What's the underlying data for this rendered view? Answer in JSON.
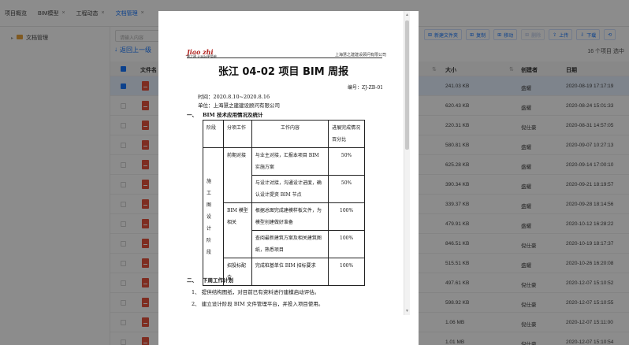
{
  "tabs": [
    {
      "label": "项目概览",
      "close": ""
    },
    {
      "label": "BIM模型",
      "close": "×"
    },
    {
      "label": "工程动态",
      "close": "×"
    },
    {
      "label": "文档管理",
      "close": "×"
    }
  ],
  "sidebar": {
    "folder_label": "文档管理"
  },
  "search": {
    "placeholder": "请输入内容"
  },
  "back_label": "返回上一级",
  "toolbar": [
    {
      "label": "新建文件夹",
      "icon": "new-folder-icon",
      "icon_glyph": "⊞"
    },
    {
      "label": "复制",
      "icon": "copy-icon",
      "icon_glyph": "⊞"
    },
    {
      "label": "移动",
      "icon": "move-icon",
      "icon_glyph": "⊞"
    },
    {
      "label": "删除",
      "icon": "delete-icon",
      "icon_glyph": "⊞"
    },
    {
      "label": "上传",
      "icon": "upload-icon",
      "icon_glyph": "⇪"
    },
    {
      "label": "下载",
      "icon": "download-icon",
      "icon_glyph": "⇩"
    },
    {
      "label": "⟲",
      "icon": "share-icon",
      "icon_glyph": ""
    }
  ],
  "item_count": "16 个项目 选中",
  "columns": {
    "name": "文件名",
    "size": "大小",
    "creator": "创建者",
    "date": "日期"
  },
  "files": [
    {
      "size": "241.03 KB",
      "creator": "盛耀",
      "date": "2020-08-19 17:17:19",
      "selected": true
    },
    {
      "size": "620.43 KB",
      "creator": "盛耀",
      "date": "2020-08-24 15:01:33",
      "selected": false
    },
    {
      "size": "220.31 KB",
      "creator": "倪仕豪",
      "date": "2020-08-31 14:57:05",
      "selected": false
    },
    {
      "size": "580.81 KB",
      "creator": "盛耀",
      "date": "2020-09-07 10:27:13",
      "selected": false
    },
    {
      "size": "625.28 KB",
      "creator": "盛耀",
      "date": "2020-09-14 17:00:10",
      "selected": false
    },
    {
      "size": "390.34 KB",
      "creator": "盛耀",
      "date": "2020-09-21 18:19:57",
      "selected": false
    },
    {
      "size": "339.37 KB",
      "creator": "盛耀",
      "date": "2020-09-28 18:14:56",
      "selected": false
    },
    {
      "size": "479.91 KB",
      "creator": "盛耀",
      "date": "2020-10-12 16:28:22",
      "selected": false
    },
    {
      "size": "846.51 KB",
      "creator": "倪仕豪",
      "date": "2020-10-19 18:17:37",
      "selected": false
    },
    {
      "size": "515.51 KB",
      "creator": "盛耀",
      "date": "2020-10-26 16:20:08",
      "selected": false
    },
    {
      "size": "497.61 KB",
      "creator": "倪仕豪",
      "date": "2020-12-07 15:10:52",
      "selected": false
    },
    {
      "size": "598.92 KB",
      "creator": "倪仕豪",
      "date": "2020-12-07 15:10:55",
      "selected": false
    },
    {
      "size": "1.06 MB",
      "creator": "倪仕豪",
      "date": "2020-12-07 15:11:00",
      "selected": false
    },
    {
      "size": "1.01 MB",
      "creator": "倪仕豪",
      "date": "2020-12-07 15:10:54",
      "selected": false
    }
  ],
  "document": {
    "logo_text": "Jiao zhi",
    "logo_sub": "慧之建 让BIM更简单",
    "header_company": "上海慧之建建设顾问有限公司",
    "title": "张江 04-02 项目 BIM 周报",
    "number": "编号：ZJ-ZB-01",
    "time": "时间：2020.8.10~2020.8.16",
    "unit": "单位：上海慧之建建设顾问有限公司",
    "section1_no": "一、",
    "section1": "BIM 技术应用情况及统计",
    "table_header": {
      "stage": "阶段",
      "task": "分项工作",
      "content": "工作内容",
      "progress": "进展完成情况百分比"
    },
    "stage_name": "施工图设计阶段",
    "rows": [
      {
        "task": "前期对接",
        "content": "与业主对接，汇报本项目 BIM 实施方案",
        "pct": "50%"
      },
      {
        "task": "",
        "content": "与设计对接，沟通设计进度，确认设计提资 BIM 节点",
        "pct": "50%"
      },
      {
        "task": "BIM 模型相关",
        "content": "根据总图完成建模样板文件，为模型创建做好准备",
        "pct": "100%"
      },
      {
        "task": "",
        "content": "查阅最新建筑方案及相关建筑图纸，熟悉项目",
        "pct": "100%"
      },
      {
        "task": "招投标配合",
        "content": "完成桩基单位 BIM 招标要求",
        "pct": "100%"
      }
    ],
    "section2_no": "二、",
    "section2": "下周工作计划",
    "plan": [
      "1、 提供结构图纸，对目前已有资料进行建模启动评估。",
      "2、 建立设计阶段 BIM 文件管理平台，并投入项目使用。"
    ]
  }
}
